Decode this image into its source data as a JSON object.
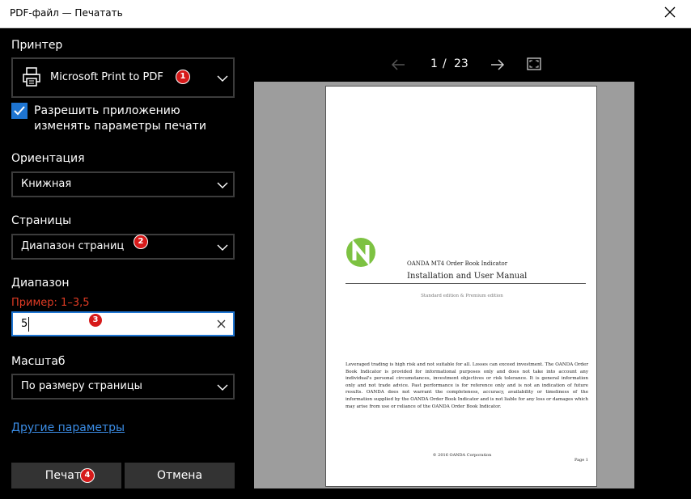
{
  "window": {
    "title": "PDF-файл — Печатать"
  },
  "printer": {
    "label": "Принтер",
    "selected": "Microsoft Print to PDF",
    "allow_app_settings": "Разрешить приложению изменять параметры печати",
    "allow_checked": true
  },
  "orientation": {
    "label": "Ориентация",
    "selected": "Книжная"
  },
  "pages": {
    "label": "Страницы",
    "selected": "Диапазон страниц"
  },
  "range": {
    "label": "Диапазон",
    "hint": "Пример: 1–3,5",
    "value": "5"
  },
  "scale": {
    "label": "Масштаб",
    "selected": "По размеру страницы"
  },
  "more_settings": "Другие параметры",
  "buttons": {
    "print": "Печать",
    "cancel": "Отмена"
  },
  "badges": [
    "1",
    "2",
    "3",
    "4"
  ],
  "preview": {
    "current_page": "1",
    "separator": "/",
    "total_pages": "23",
    "doc_line1": "OANDA MT4 Order Book Indicator",
    "doc_line2": "Installation and User Manual",
    "doc_edition": "Standard edition & Premium edition",
    "doc_body": "Leveraged trading is high risk and not suitable for all. Losses can exceed investment. The OANDA Order Book Indicator is provided for informational purposes only and does not take into account any individual's personal circumstances, investment objectives or risk tolerance. It is general information only and not trade advice. Past performance is for reference only and is not an indication of future results. OANDA does not warrant the completeness, accuracy, availability or timeliness of the information supplied by the OANDA Order Book Indicator and is not liable for any loss or damages which may arise from use or reliance of the OANDA Order Book Indicator.",
    "doc_copyright": "© 2016 OANDA Corporation",
    "doc_page": "Page 1"
  },
  "colors": {
    "accent": "#1e75d2",
    "hint": "#e03b24",
    "badge": "#d61a1a",
    "logo": "#7dc242"
  }
}
